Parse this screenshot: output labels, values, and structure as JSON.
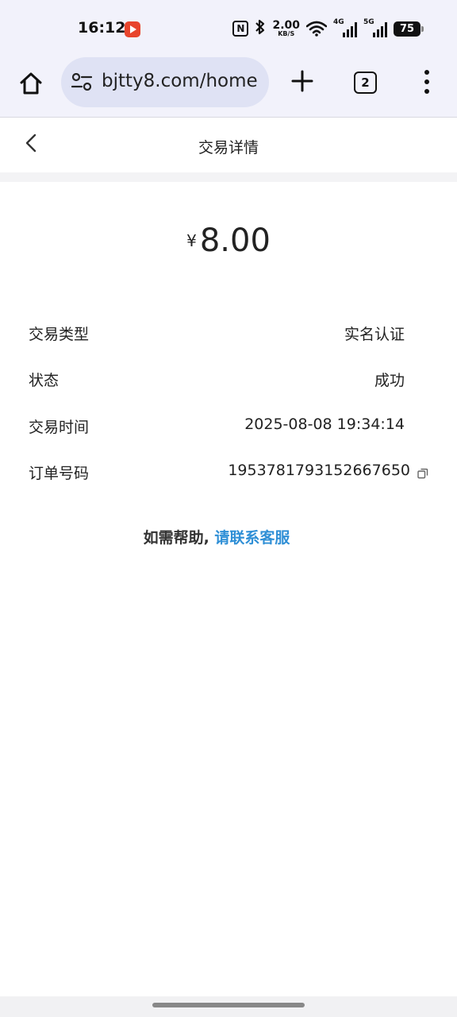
{
  "status_bar": {
    "time": "16:12",
    "nfc": "N",
    "net_speed_value": "2.00",
    "net_speed_unit": "KB/S",
    "signal_1_label": "4G",
    "signal_2_label": "5G",
    "battery": "75",
    "icons": [
      "video-app-icon",
      "nfc-icon",
      "bluetooth-icon",
      "wifi-icon",
      "signal-icon",
      "battery-icon"
    ]
  },
  "browser": {
    "url": "bjtty8.com/home",
    "tab_count": "2",
    "icons": [
      "home-icon",
      "site-settings-icon",
      "plus-icon",
      "tabs-icon",
      "more-vert-icon"
    ]
  },
  "page": {
    "title": "交易详情",
    "amount_currency": "¥",
    "amount_value": "8.00",
    "rows": [
      {
        "label": "交易类型",
        "value": "实名认证"
      },
      {
        "label": "状态",
        "value": "成功"
      },
      {
        "label": "交易时间",
        "value": "2025-08-08 19:34:14"
      },
      {
        "label": "订单号码",
        "value": "1953781793152667650"
      }
    ],
    "help_prefix": "如需帮助, ",
    "help_link": "请联系客服",
    "link_color": "#2f8fd6"
  }
}
